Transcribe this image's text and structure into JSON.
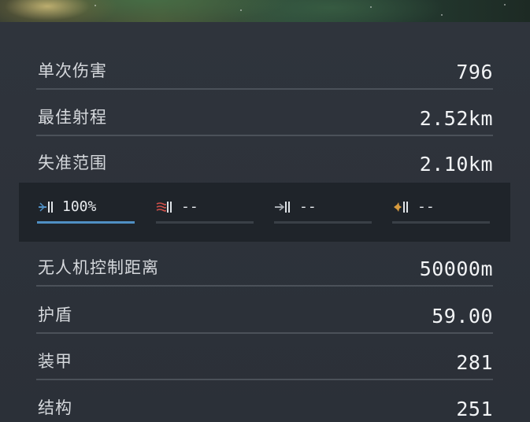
{
  "stats_top": [
    {
      "label": "单次伤害",
      "value": "796"
    },
    {
      "label": "最佳射程",
      "value": "2.52km"
    },
    {
      "label": "失准范围",
      "value": "2.10km"
    }
  ],
  "damage_profile": [
    {
      "icon": "em-damage-icon",
      "value": "100%",
      "fraction": 1.0,
      "color": "#4f8fc4"
    },
    {
      "icon": "thermal-damage-icon",
      "value": "--",
      "fraction": 0,
      "color": "#d0504a"
    },
    {
      "icon": "kinetic-damage-icon",
      "value": "--",
      "fraction": 0,
      "color": "#a8adb3"
    },
    {
      "icon": "explosive-damage-icon",
      "value": "--",
      "fraction": 0,
      "color": "#d79a3e"
    }
  ],
  "stats_bottom": [
    {
      "label": "无人机控制距离",
      "value": "50000m"
    },
    {
      "label": "护盾",
      "value": "59.00"
    },
    {
      "label": "装甲",
      "value": "281"
    },
    {
      "label": "结构",
      "value": "251"
    }
  ]
}
